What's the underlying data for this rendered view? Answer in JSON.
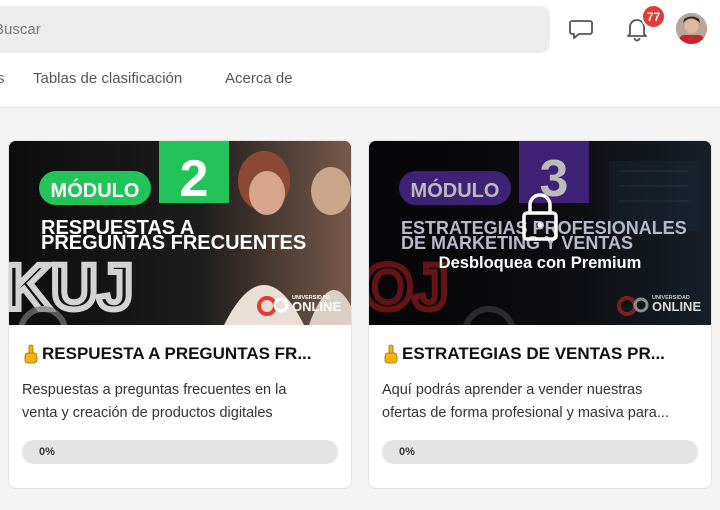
{
  "search": {
    "placeholder": "Buscar"
  },
  "header": {
    "notifications_count": "77",
    "nav_fragment": "s",
    "nav": [
      {
        "label": "Tablas de clasificación"
      },
      {
        "label": "Acerca de"
      }
    ]
  },
  "colors": {
    "accent_green": "#22c45a",
    "accent_purple": "#6f3fd8",
    "badge_red": "#e53935"
  },
  "courses": [
    {
      "module_word": "MÓDULO",
      "module_number": "2",
      "banner_line1": "RESPUESTAS A",
      "banner_line2": "PREGUNTAS FRECUENTES",
      "brand_small": "UNIVERSIDAD",
      "brand_big": "ONLINE",
      "title": "RESPUESTA A PREGUNTAS FR...",
      "desc_line1": "Respuestas a preguntas frecuentes en la",
      "desc_line2": "venta y creación de productos digitales",
      "progress_label": "0%",
      "progress": 0,
      "locked": false
    },
    {
      "module_word": "MÓDULO",
      "module_number": "3",
      "banner_line1": "ESTRATEGIAS PROFESIONALES",
      "banner_line2": "DE MARKETING Y VENTAS",
      "brand_small": "UNIVERSIDAD",
      "brand_big": "ONLINE",
      "lock_label": "Desbloquea con Premium",
      "title": "ESTRATEGIAS DE VENTAS PR...",
      "desc_line1": "Aquí podrás aprender a vender nuestras",
      "desc_line2": "ofertas de forma profesional y masiva para...",
      "progress_label": "0%",
      "progress": 0,
      "locked": true
    }
  ]
}
